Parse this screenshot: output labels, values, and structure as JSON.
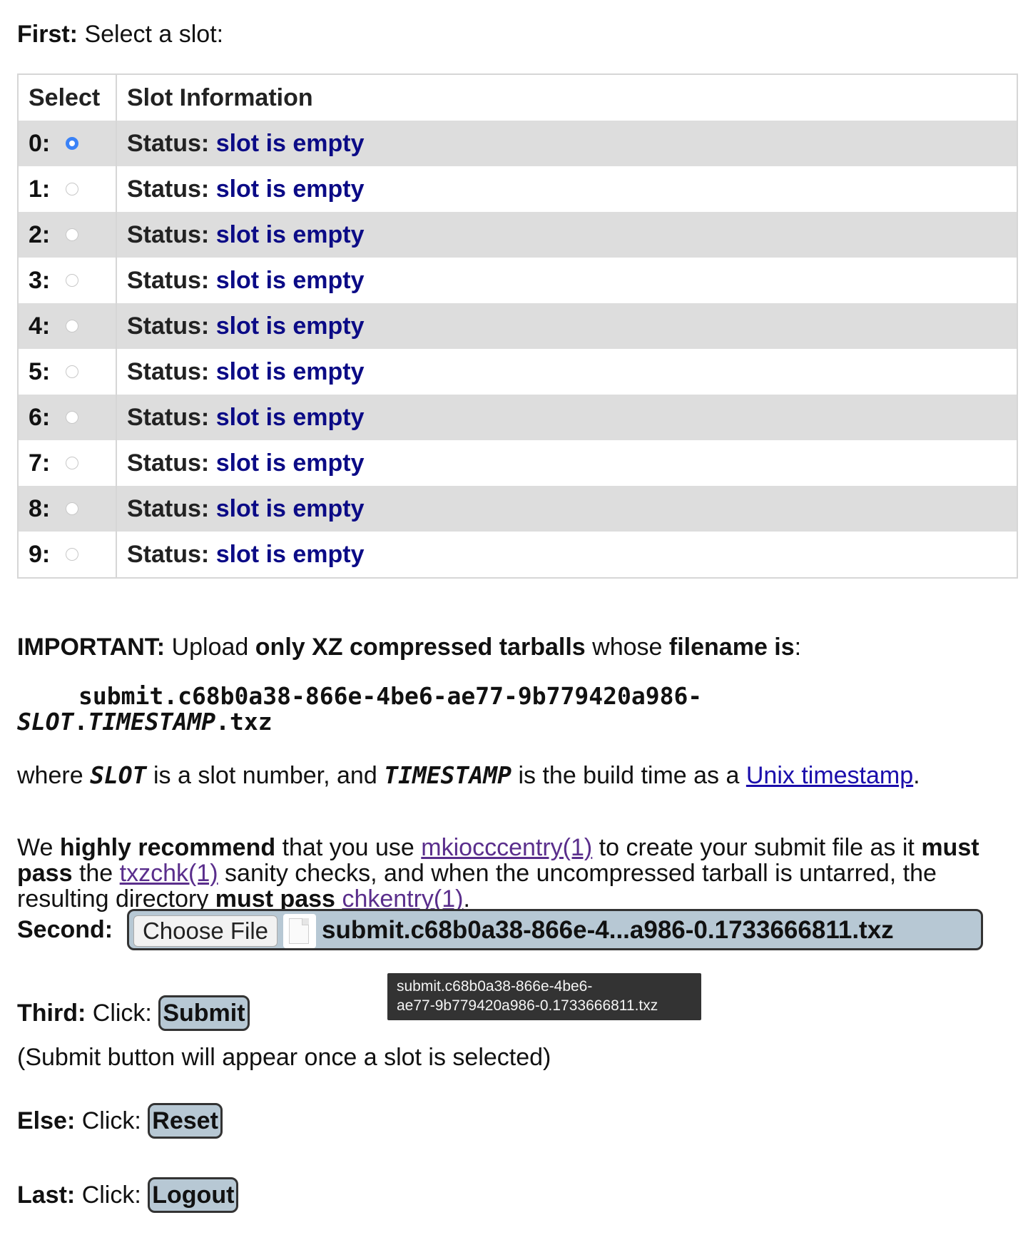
{
  "intro": {
    "label": "First:",
    "text": "Select a slot:"
  },
  "table": {
    "headers": {
      "select": "Select",
      "info": "Slot Information"
    },
    "status_label": "Status:",
    "rows": [
      {
        "num": "0:",
        "status": "slot is empty",
        "selected": true
      },
      {
        "num": "1:",
        "status": "slot is empty",
        "selected": false
      },
      {
        "num": "2:",
        "status": "slot is empty",
        "selected": false
      },
      {
        "num": "3:",
        "status": "slot is empty",
        "selected": false
      },
      {
        "num": "4:",
        "status": "slot is empty",
        "selected": false
      },
      {
        "num": "5:",
        "status": "slot is empty",
        "selected": false
      },
      {
        "num": "6:",
        "status": "slot is empty",
        "selected": false
      },
      {
        "num": "7:",
        "status": "slot is empty",
        "selected": false
      },
      {
        "num": "8:",
        "status": "slot is empty",
        "selected": false
      },
      {
        "num": "9:",
        "status": "slot is empty",
        "selected": false
      }
    ]
  },
  "important": {
    "label": "IMPORTANT:",
    "t1": "Upload",
    "b1": "only XZ compressed tarballs",
    "t2": "whose",
    "b2": "filename is",
    "t3": ":"
  },
  "filename": {
    "line1": "submit.c68b0a38-866e-4be6-ae77-9b779420a986-",
    "slot": "SLOT",
    "dot": ".",
    "timestamp": "TIMESTAMP",
    "ext": ".txz"
  },
  "where": {
    "t1": "where",
    "slot": "SLOT",
    "t2": "is a slot number, and",
    "timestamp": "TIMESTAMP",
    "t3": "is the build time as a",
    "link": "Unix timestamp",
    "t4": "."
  },
  "recommend": {
    "t1": "We",
    "b1": "highly recommend",
    "t2": "that you use",
    "link1": "mkiocccentry(1)",
    "t3": "to create your submit file as it",
    "b2": "must pass",
    "t4": "the",
    "link2": "txzchk(1)",
    "t5": "sanity checks, and when the uncompressed tarball is untarred, the resulting directory",
    "b3": "must pass",
    "link3": "chkentry(1)",
    "t6": "."
  },
  "second": {
    "label": "Second:",
    "choose_button": "Choose File",
    "file_icon": "file-icon",
    "selected_file": "submit.c68b0a38-866e-4...a986-0.1733666811.txz",
    "tooltip_line1": "submit.c68b0a38-866e-4be6-",
    "tooltip_line2": "ae77-9b779420a986-0.1733666811.txz"
  },
  "third": {
    "label": "Third:",
    "text": "Click:",
    "button": "Submit",
    "note": "(Submit button will appear once a slot is selected)"
  },
  "else": {
    "label": "Else:",
    "text": "Click:",
    "button": "Reset"
  },
  "last": {
    "label": "Last:",
    "text": "Click:",
    "button": "Logout"
  },
  "colors": {
    "accent_radio": "#3a82f7",
    "status_text": "#0b0b86",
    "button_bg": "#b7c8d4",
    "row_alt": "#dddddd"
  }
}
